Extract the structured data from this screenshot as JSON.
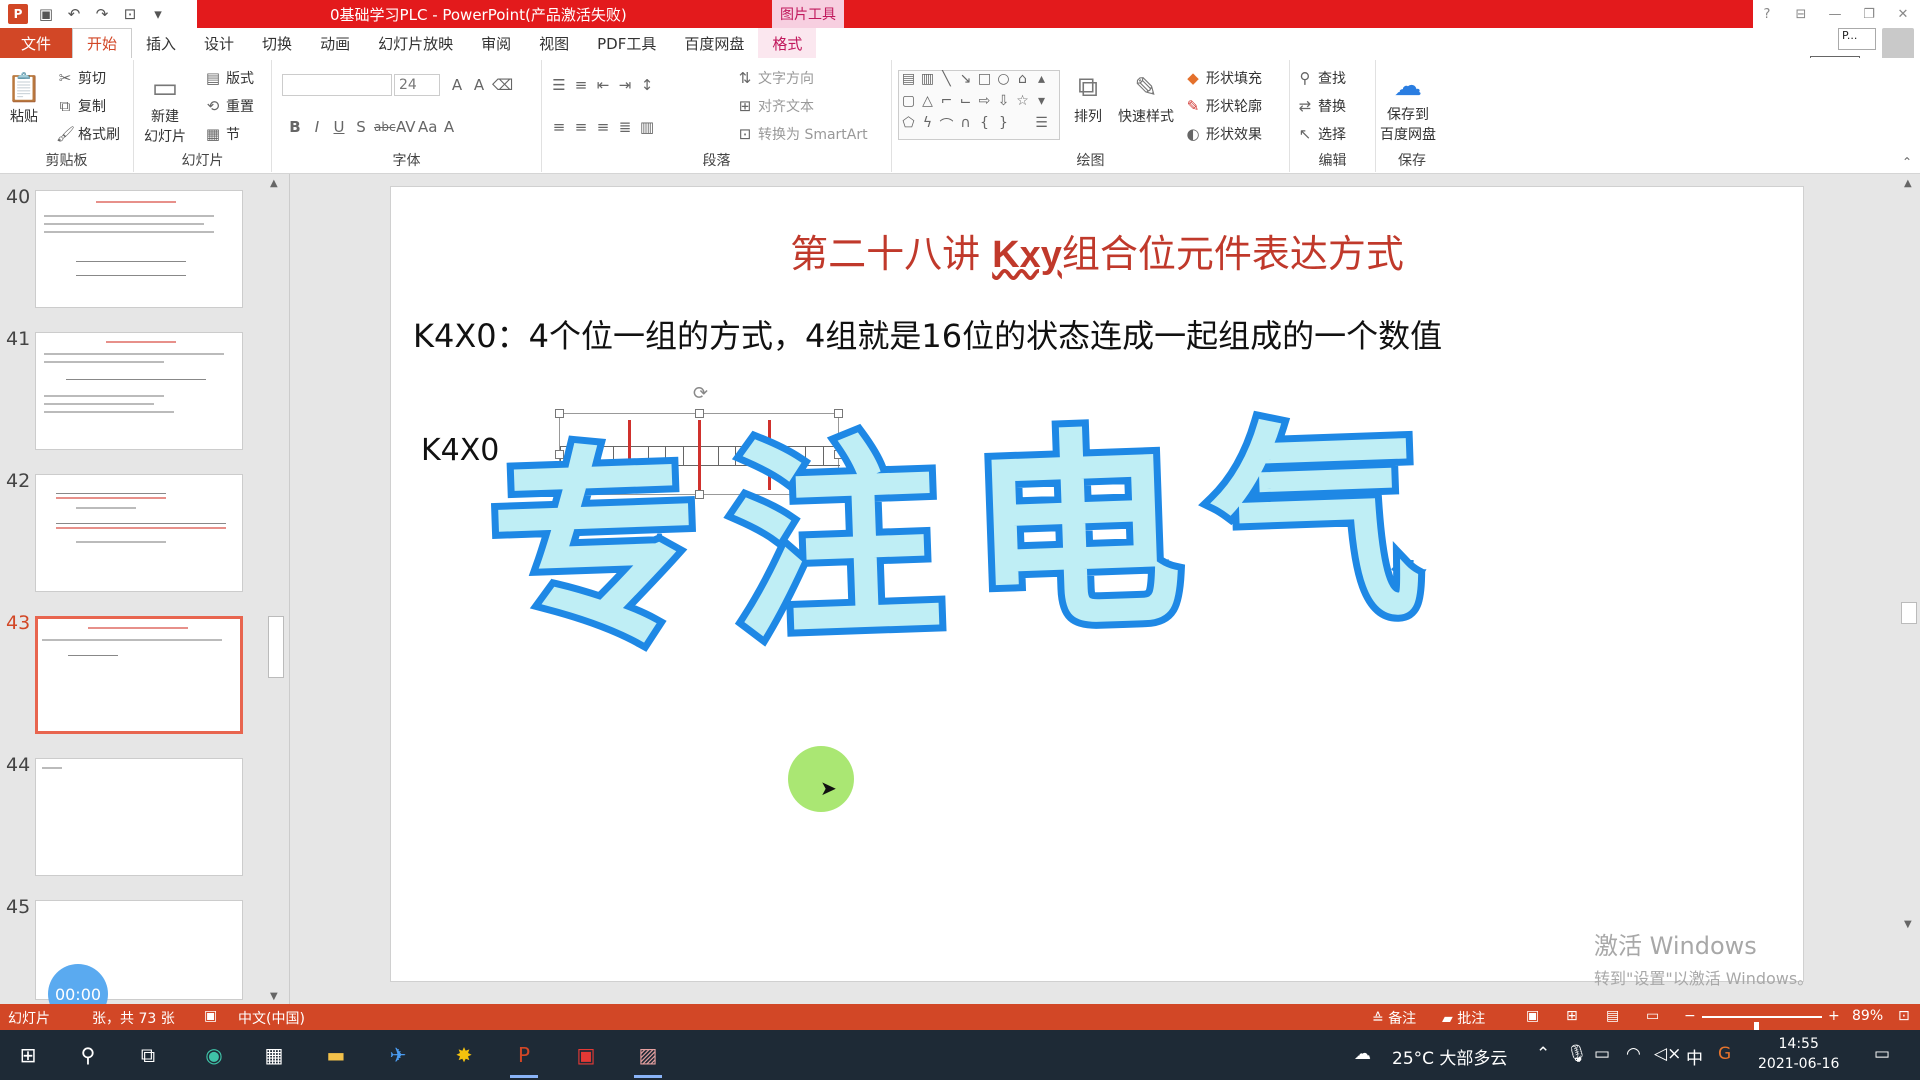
{
  "titlebar": {
    "doc_title": "0基础学习PLC - PowerPoint(产品激活失败)",
    "context_tab": "图片工具",
    "help": "?"
  },
  "tabs": [
    "文件",
    "开始",
    "插入",
    "设计",
    "切换",
    "动画",
    "幻灯片放映",
    "审阅",
    "视图",
    "PDF工具",
    "百度网盘",
    "格式"
  ],
  "account": {
    "name": "P...",
    "tooltip": "开始"
  },
  "ribbon": {
    "clipboard": {
      "paste": "粘贴",
      "cut": "剪切",
      "copy": "复制",
      "painter": "格式刷",
      "label": "剪贴板"
    },
    "slides": {
      "new": "新建",
      "new2": "幻灯片",
      "layout": "版式",
      "reset": "重置",
      "section": "节",
      "label": "幻灯片"
    },
    "font": {
      "size": "24",
      "label": "字体"
    },
    "paragraph": {
      "text_dir": "文字方向",
      "align_text": "对齐文本",
      "smartart": "转换为 SmartArt",
      "label": "段落"
    },
    "drawing": {
      "arrange": "排列",
      "quick_styles": "快速样式",
      "fill": "形状填充",
      "outline": "形状轮廓",
      "effects": "形状效果",
      "label": "绘图"
    },
    "editing": {
      "find": "查找",
      "replace": "替换",
      "select": "选择",
      "label": "编辑"
    },
    "save": {
      "line1": "保存到",
      "line2": "百度网盘",
      "label": "保存"
    }
  },
  "thumbnails": {
    "numbers": [
      "40",
      "41",
      "42",
      "43",
      "44",
      "45"
    ],
    "active": "43"
  },
  "slide": {
    "title_pre": "第二十八讲 ",
    "title_kxy": "Kxy",
    "title_post": "组合位元件表达方式",
    "body": "K4X0：4个位一组的方式，4组就是16位的状态连成一起组成的一个数值",
    "label": "K4X0",
    "watermark": "专注电气",
    "bits": 16
  },
  "activate": {
    "line1": "激活 Windows",
    "line2": "转到\"设置\"以激活 Windows。"
  },
  "timer": "00:00",
  "statusbar": {
    "slide_info": "幻灯片",
    "slide_count": "张，共 73 张",
    "language": "中文(中国)",
    "notes": "备注",
    "comments": "批注",
    "zoom": "89%",
    "zoom_level": 0.45
  },
  "taskbar": {
    "weather": "25°C 大部多云",
    "ime": "中",
    "time": "14:55",
    "date": "2021-06-16"
  },
  "colors": {
    "accent": "#d24726",
    "titlebar_red": "#e31a1c",
    "slide_title": "#c0392b",
    "watermark_fill": "#bfeef5",
    "watermark_stroke": "#1e88e5"
  }
}
